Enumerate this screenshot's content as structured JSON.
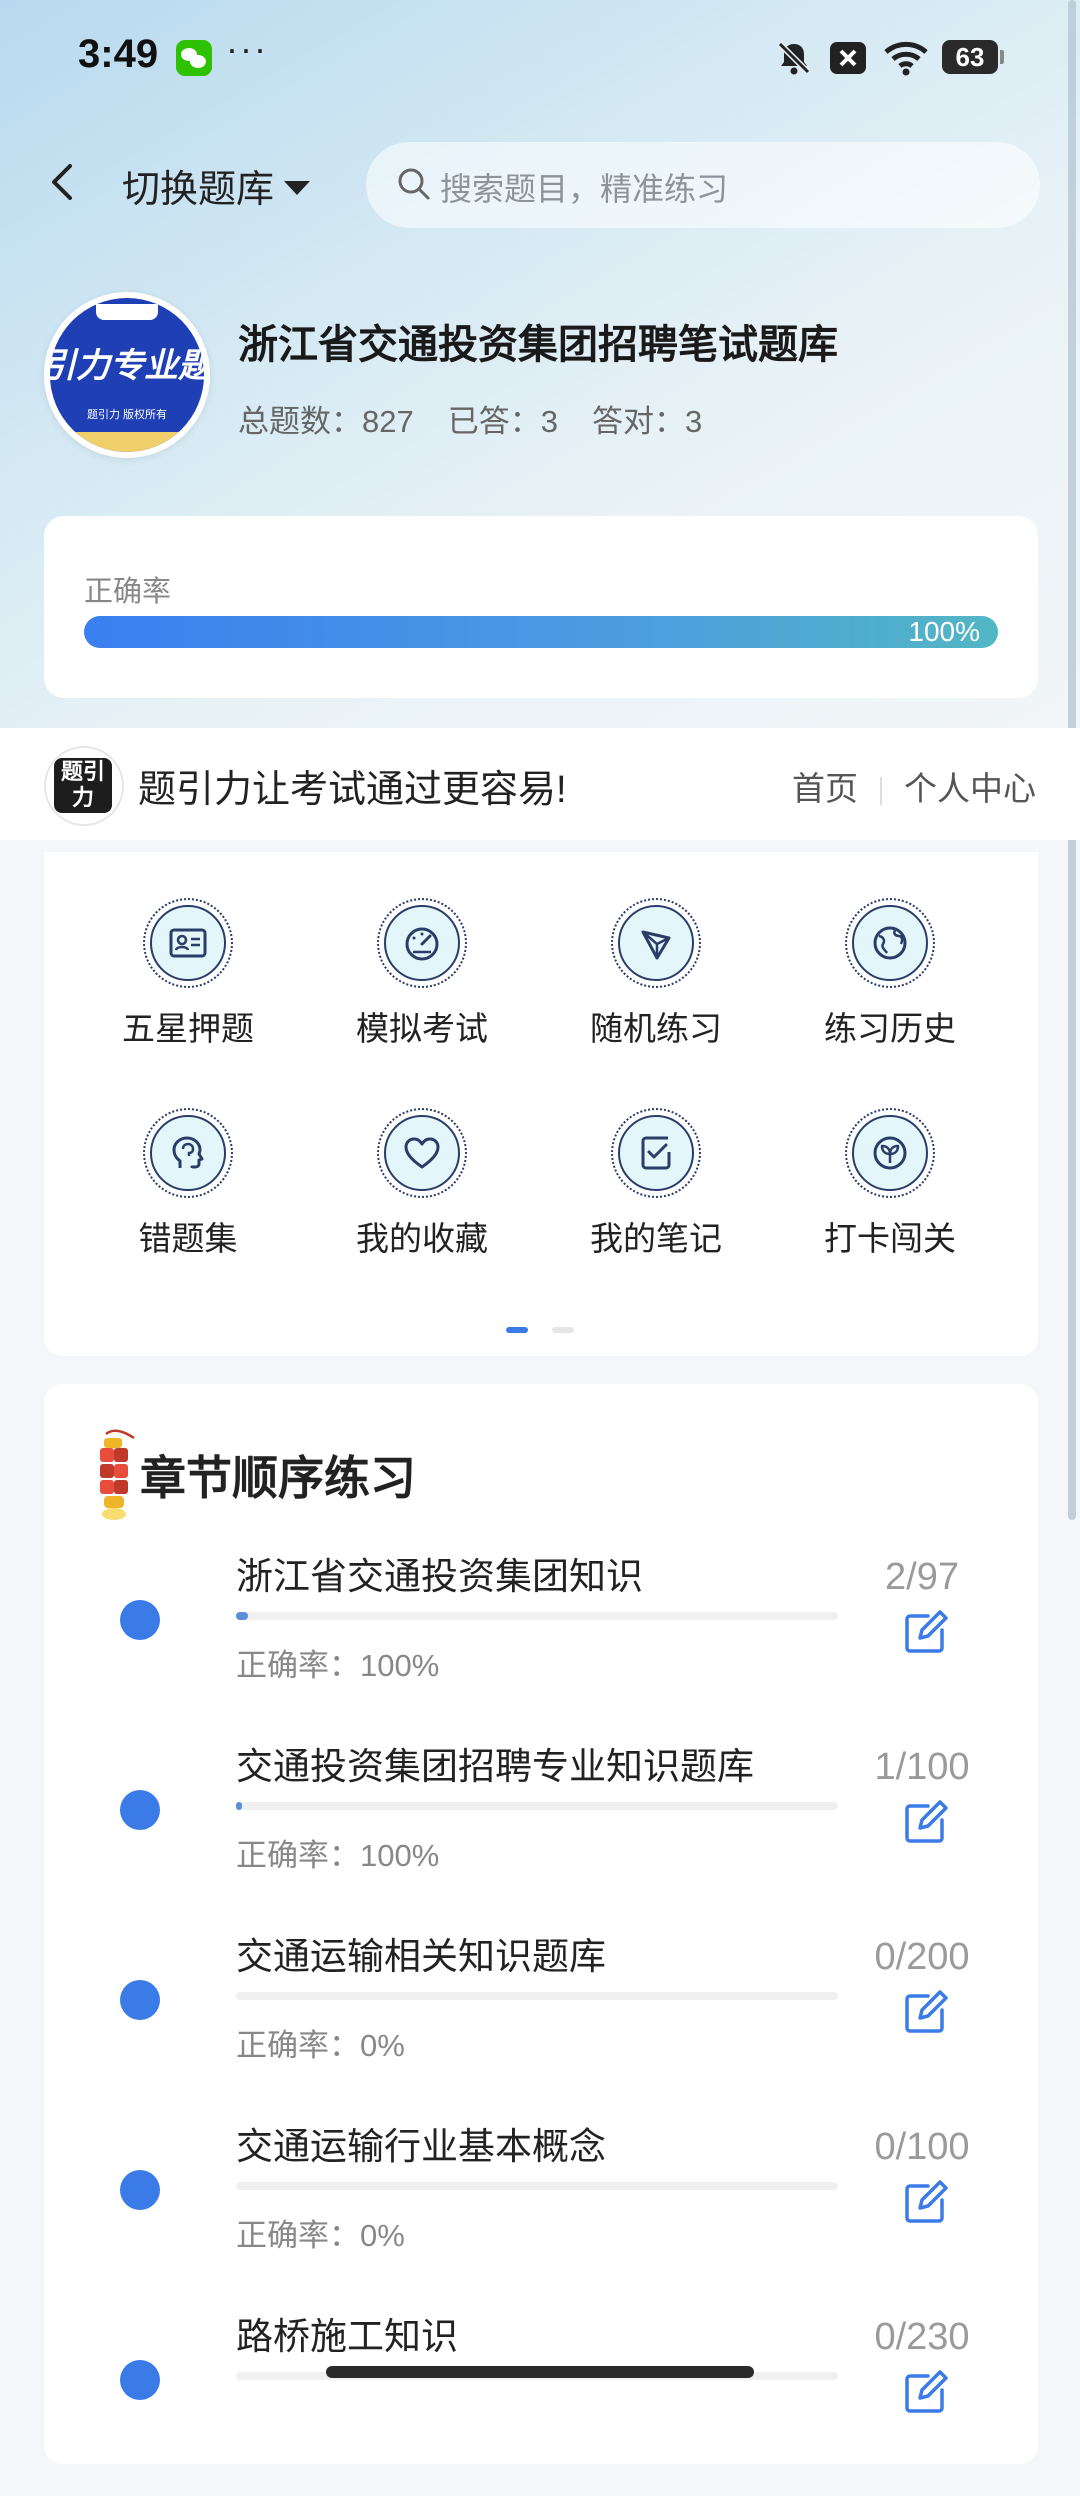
{
  "status_bar": {
    "time": "3:49",
    "dots": "···",
    "battery": "63"
  },
  "header": {
    "switch_label": "切换题库",
    "search_placeholder": "搜索题目，精准练习"
  },
  "bank": {
    "title": "浙江省交通投资集团招聘笔试题库",
    "logo_text": "引力专业题",
    "logo_small": "题引力 版权所有",
    "stats": [
      {
        "label": "总题数：827"
      },
      {
        "label": "已答：3"
      },
      {
        "label": "答对：3"
      }
    ]
  },
  "accuracy": {
    "label": "正确率",
    "value": "100%",
    "fraction": 1.0
  },
  "slogan": {
    "logo_text": "题引力",
    "text": "题引力让考试通过更容易!",
    "nav": [
      "首页",
      "个人中心"
    ]
  },
  "grid_menu": {
    "items": [
      {
        "label": "五星押题",
        "icon": "id-card-icon"
      },
      {
        "label": "模拟考试",
        "icon": "speedometer-icon"
      },
      {
        "label": "随机练习",
        "icon": "network-icon"
      },
      {
        "label": "练习历史",
        "icon": "globe-icon"
      },
      {
        "label": "错题集",
        "icon": "brain-head-icon"
      },
      {
        "label": "我的收藏",
        "icon": "heart-icon"
      },
      {
        "label": "我的笔记",
        "icon": "checklist-icon"
      },
      {
        "label": "打卡闯关",
        "icon": "sprout-icon"
      }
    ],
    "page_count": 2,
    "current_page": 1
  },
  "chapters": {
    "title": "章节顺序练习",
    "items": [
      {
        "name": "浙江省交通投资集团知识",
        "accuracy": "正确率：100%",
        "count": "2/97",
        "progress": 0.0206
      },
      {
        "name": "交通投资集团招聘专业知识题库",
        "accuracy": "正确率：100%",
        "count": "1/100",
        "progress": 0.01
      },
      {
        "name": "交通运输相关知识题库",
        "accuracy": "正确率：0%",
        "count": "0/200",
        "progress": 0
      },
      {
        "name": "交通运输行业基本概念",
        "accuracy": "正确率：0%",
        "count": "0/100",
        "progress": 0
      },
      {
        "name": "路桥施工知识",
        "accuracy": "",
        "count": "0/230",
        "progress": 0
      }
    ]
  },
  "colors": {
    "accent": "#3a7be8",
    "icon_bg": "#e3f7fb",
    "icon_stroke": "#2a3d68"
  }
}
